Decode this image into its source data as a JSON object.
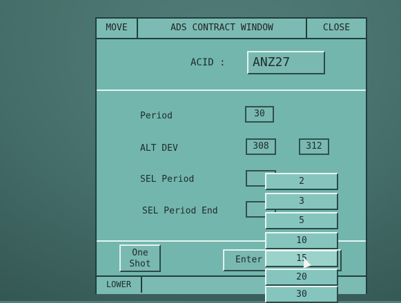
{
  "window": {
    "move_label": "MOVE",
    "title": "ADS CONTRACT WINDOW",
    "close_label": "CLOSE"
  },
  "acid": {
    "label": "ACID :",
    "value": "ANZ27"
  },
  "fields": {
    "period_label": "Period",
    "period_value": "30",
    "altdev_label": "ALT DEV",
    "altdev_value_1": "308",
    "altdev_value_2": "312",
    "sel_period_label": "SEL Period",
    "sel_period_value": "",
    "sel_period_end_label": "SEL Period End",
    "sel_period_end_value": ""
  },
  "buttons": {
    "one_shot_line1": "One",
    "one_shot_line2": "Shot",
    "enter_label": "Enter",
    "lower_label": "LOWER"
  },
  "dropdown": {
    "options": [
      "2",
      "3",
      "5",
      "10",
      "15",
      "20",
      "30"
    ],
    "hovered_option": "15"
  }
}
